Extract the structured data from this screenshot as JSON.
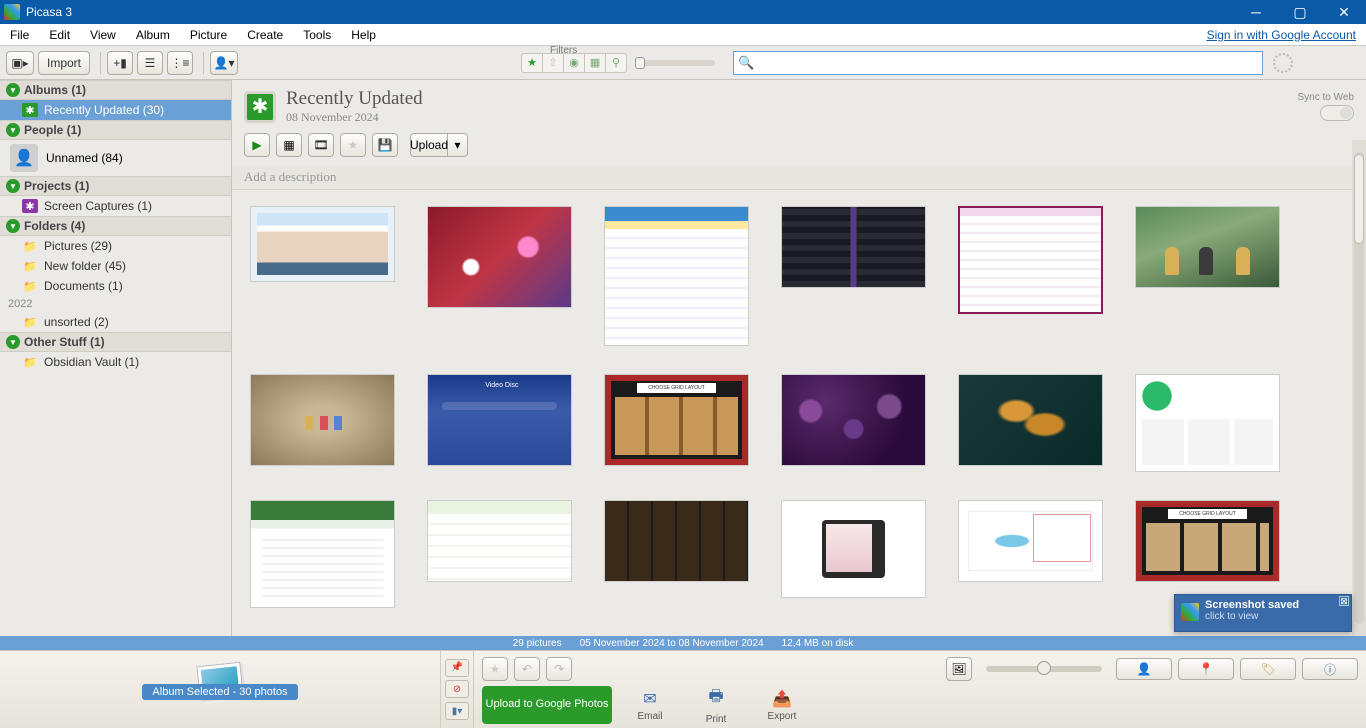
{
  "app_title": "Picasa 3",
  "menu": [
    "File",
    "Edit",
    "View",
    "Album",
    "Picture",
    "Create",
    "Tools",
    "Help"
  ],
  "signin_text": "Sign in with Google Account",
  "toolbar": {
    "import_label": "Import",
    "filters_label": "Filters"
  },
  "sidebar": {
    "albums_header": "Albums (1)",
    "recently_updated": "Recently Updated (30)",
    "people_header": "People (1)",
    "unnamed": "Unnamed (84)",
    "projects_header": "Projects (1)",
    "screen_captures": "Screen Captures (1)",
    "folders_header": "Folders (4)",
    "pictures": "Pictures (29)",
    "new_folder": "New folder (45)",
    "documents": "Documents (1)",
    "year_2022": "2022",
    "unsorted": "unsorted (2)",
    "other_header": "Other Stuff (1)",
    "obsidian": "Obsidian Vault (1)"
  },
  "album": {
    "title": "Recently Updated",
    "date": "08 November 2024",
    "sync_label": "Sync to Web",
    "upload_label": "Upload",
    "description_placeholder": "Add a description"
  },
  "status": {
    "count": "29 pictures",
    "range": "05 November 2024 to 08 November 2024",
    "size": "12,4 MB on disk"
  },
  "tray": {
    "chip": "Album Selected - 30 photos"
  },
  "bottom": {
    "upload_btn": "Upload to Google Photos",
    "email": "Email",
    "print": "Print",
    "export": "Export"
  },
  "toast": {
    "title": "Screenshot saved",
    "sub": "click to view"
  }
}
